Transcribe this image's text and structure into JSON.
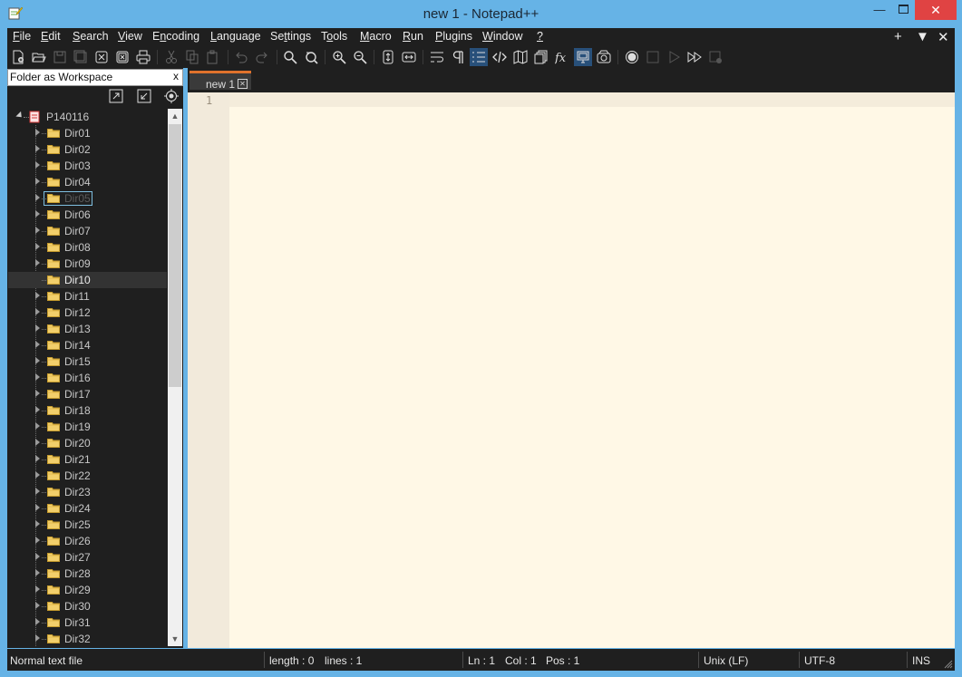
{
  "window": {
    "title": "new 1 - Notepad++",
    "controls": {
      "minimize": "—",
      "close": "✕"
    }
  },
  "menu": {
    "items": [
      {
        "pre": "",
        "key": "F",
        "post": "ile"
      },
      {
        "pre": "",
        "key": "E",
        "post": "dit"
      },
      {
        "pre": "",
        "key": "S",
        "post": "earch"
      },
      {
        "pre": "",
        "key": "V",
        "post": "iew"
      },
      {
        "pre": "E",
        "key": "n",
        "post": "coding"
      },
      {
        "pre": "",
        "key": "L",
        "post": "anguage"
      },
      {
        "pre": "Se",
        "key": "t",
        "post": "tings"
      },
      {
        "pre": "T",
        "key": "o",
        "post": "ols"
      },
      {
        "pre": "",
        "key": "M",
        "post": "acro"
      },
      {
        "pre": "",
        "key": "R",
        "post": "un"
      },
      {
        "pre": "",
        "key": "P",
        "post": "lugins"
      },
      {
        "pre": "",
        "key": "W",
        "post": "indow"
      },
      {
        "pre": "",
        "key": "?",
        "post": ""
      }
    ],
    "right": {
      "add": "+",
      "dropdown": "▼",
      "close": "✕"
    }
  },
  "panel": {
    "title": "Folder as Workspace",
    "close": "x",
    "root": "P140116",
    "folders": [
      "Dir01",
      "Dir02",
      "Dir03",
      "Dir04",
      "Dir05",
      "Dir06",
      "Dir07",
      "Dir08",
      "Dir09",
      "Dir10",
      "Dir11",
      "Dir12",
      "Dir13",
      "Dir14",
      "Dir15",
      "Dir16",
      "Dir17",
      "Dir18",
      "Dir19",
      "Dir20",
      "Dir21",
      "Dir22",
      "Dir23",
      "Dir24",
      "Dir25",
      "Dir26",
      "Dir27",
      "Dir28",
      "Dir29",
      "Dir30",
      "Dir31",
      "Dir32"
    ],
    "selected": "Dir10",
    "editing": "Dir05"
  },
  "editor": {
    "tab": "new 1",
    "line_number": "1"
  },
  "status": {
    "file_type": "Normal text file",
    "length": "length : 0",
    "lines": "lines : 1",
    "ln": "Ln : 1",
    "col": "Col : 1",
    "pos": "Pos : 1",
    "eol": "Unix (LF)",
    "encoding": "UTF-8",
    "mode": "INS"
  },
  "colors": {
    "title_bar": "#66b3e6",
    "dark_bg": "#1f1f1f",
    "editor_bg": "#fff8e6",
    "tab_accent": "#e0722c",
    "selection": "#333333"
  }
}
